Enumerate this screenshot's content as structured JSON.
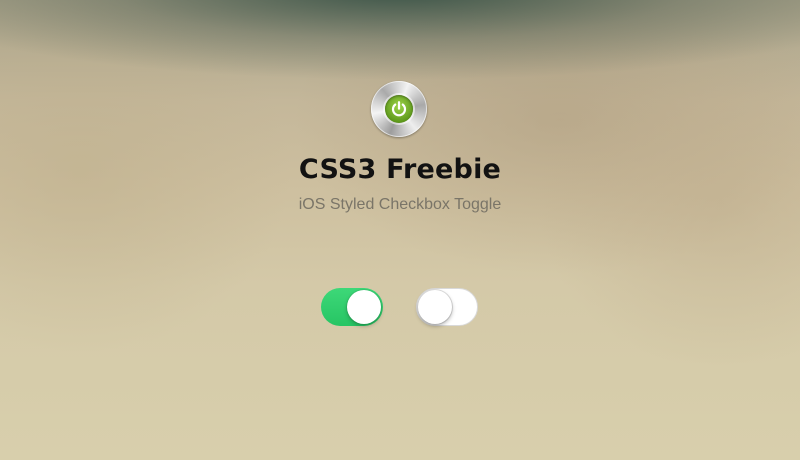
{
  "header": {
    "icon": "power-icon",
    "title": "CSS3 Freebie",
    "subtitle": "iOS Styled Checkbox Toggle"
  },
  "toggles": [
    {
      "state": "on",
      "color": "#2ecc71"
    },
    {
      "state": "off",
      "color": "#ffffff"
    }
  ]
}
